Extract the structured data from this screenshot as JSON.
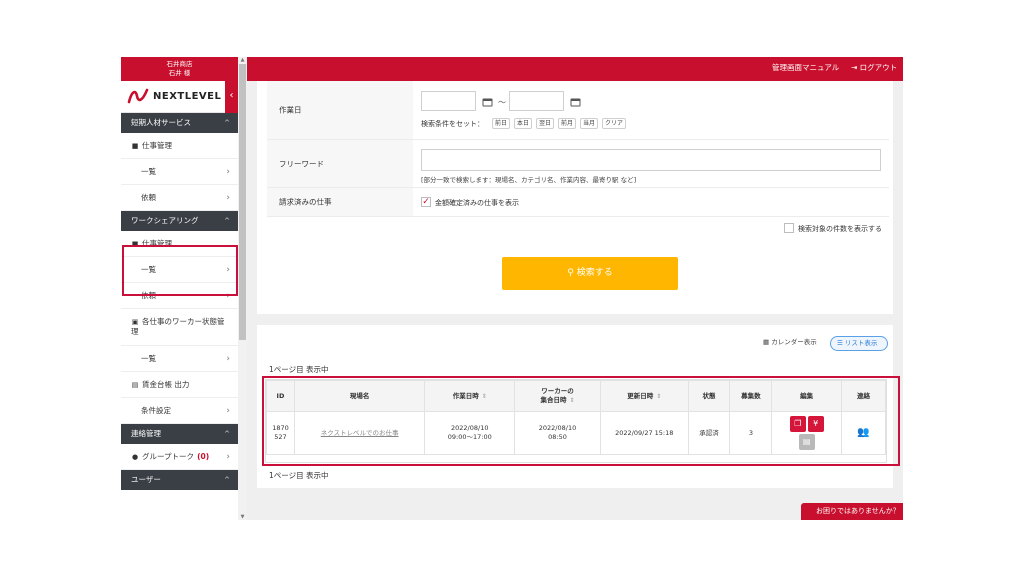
{
  "sidebar": {
    "company": "石井商店",
    "user": "石井 様",
    "logo_text": "NEXTLEVEL",
    "collapse_icon": "chevron-left-icon",
    "sections": [
      {
        "title": "短期人材サービス"
      },
      {
        "title": "ワークシェアリング"
      },
      {
        "title": "連絡管理"
      },
      {
        "title": "ユーザー"
      }
    ],
    "items": {
      "s1_job_mgmt": "仕事管理",
      "s1_list": "一覧",
      "s1_request": "依頼",
      "s2_job_mgmt": "仕事管理",
      "s2_list": "一覧",
      "s2_request": "依頼",
      "s2_worker_status": "各仕事のワーカー状態管理",
      "s2_worker_list": "一覧",
      "s2_wage_ledger": "賃金台帳 出力",
      "s2_conditions": "条件設定",
      "s3_group_talk": "グループトーク",
      "s3_group_count": "(0)"
    }
  },
  "topbar": {
    "manual": "管理画面マニュアル",
    "logout": "ログアウト"
  },
  "search_form": {
    "work_date_label": "作業日",
    "tilde": "～",
    "condition_label": "検索条件をセット：",
    "chips": [
      "前日",
      "本日",
      "翌日",
      "前月",
      "当月",
      "クリア"
    ],
    "freeword_label": "フリーワード",
    "freeword_hint": "[部分一致で検索します：現場名、カテゴリ名、作業内容、最寄り駅 など]",
    "billed_label": "請求済みの仕事",
    "billed_checkbox": "金額確定済みの仕事を表示",
    "show_count_checkbox": "検索対象の件数を表示する",
    "search_button": "検索する"
  },
  "results": {
    "calendar_view": "カレンダー表示",
    "list_view": "リスト表示",
    "page_status_top": "1ページ目 表示中",
    "page_status_bottom": "1ページ目 表示中",
    "columns": {
      "id": "ID",
      "site": "現場名",
      "work_datetime": "作業日時",
      "gather_line1": "ワーカーの",
      "gather_line2": "集合日時",
      "updated": "更新日時",
      "status": "状態",
      "recruit": "募集数",
      "edit": "編集",
      "contact": "連絡"
    },
    "row": {
      "id_line1": "1870",
      "id_line2": "527",
      "site": "ネクストレベルでのお仕事",
      "work_date": "2022/08/10",
      "work_time": "09:00～17:00",
      "gather_date": "2022/08/10",
      "gather_time": "08:50",
      "updated": "2022/09/27 15:18",
      "status": "承認済",
      "recruit": "3",
      "yen": "¥"
    }
  },
  "help": {
    "label": "お困りではありませんか？"
  },
  "colors": {
    "brand_red": "#c8102e",
    "sidebar_dark": "#3a3f46",
    "search_yellow": "#ffb600",
    "highlight": "#c8103a"
  }
}
